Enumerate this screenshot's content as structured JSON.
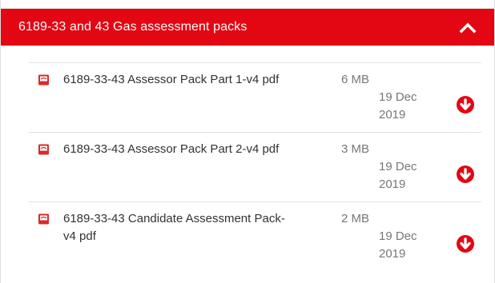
{
  "panel": {
    "title": "6189-33 and 43 Gas assessment packs",
    "toggle_icon": "chevron-up-icon",
    "colors": {
      "header_bg": "#e30613",
      "header_text": "#ffffff",
      "secondary_text": "#777777"
    }
  },
  "files": [
    {
      "name": "6189-33-43 Assessor Pack Part 1-v4 pdf",
      "size": "6 MB",
      "date_day": "19 Dec",
      "date_year": "2019",
      "file_icon": "pdf-icon",
      "action_icon": "download-icon"
    },
    {
      "name": "6189-33-43 Assessor Pack Part 2-v4 pdf",
      "size": "3 MB",
      "date_day": "19 Dec",
      "date_year": "2019",
      "file_icon": "pdf-icon",
      "action_icon": "download-icon"
    },
    {
      "name_line1": "6189-33-43 Candidate Assessment Pack-",
      "name_line2": "v4 pdf",
      "size": "2 MB",
      "date_day": "19 Dec",
      "date_year": "2019",
      "file_icon": "pdf-icon",
      "action_icon": "download-icon"
    }
  ]
}
